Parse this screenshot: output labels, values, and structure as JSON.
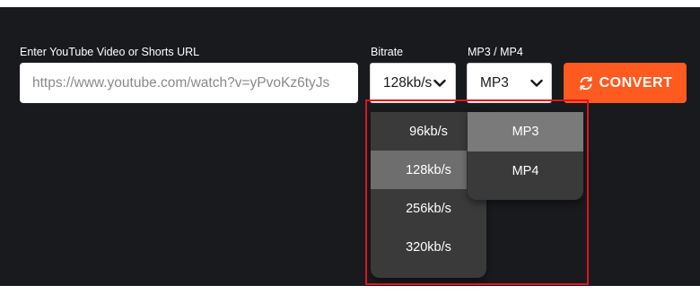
{
  "form": {
    "url_label": "Enter YouTube Video or Shorts URL",
    "url_placeholder": "https://www.youtube.com/watch?v=yPvoKz6tyJs",
    "bitrate_label": "Bitrate",
    "format_label": "MP3 / MP4",
    "bitrate_selected": "128kb/s",
    "format_selected": "MP3",
    "convert_label": "CONVERT"
  },
  "bitrate_options": [
    "96kb/s",
    "128kb/s",
    "256kb/s",
    "320kb/s"
  ],
  "format_options": [
    "MP3",
    "MP4"
  ],
  "colors": {
    "background": "#181a1e",
    "accent": "#ff5a1f",
    "highlight": "#e0141e",
    "dropdown_bg": "#3a3a3a",
    "option_selected": "#6e6e6e"
  },
  "icons": {
    "convert": "refresh-icon",
    "select": "chevron-down-icon"
  }
}
